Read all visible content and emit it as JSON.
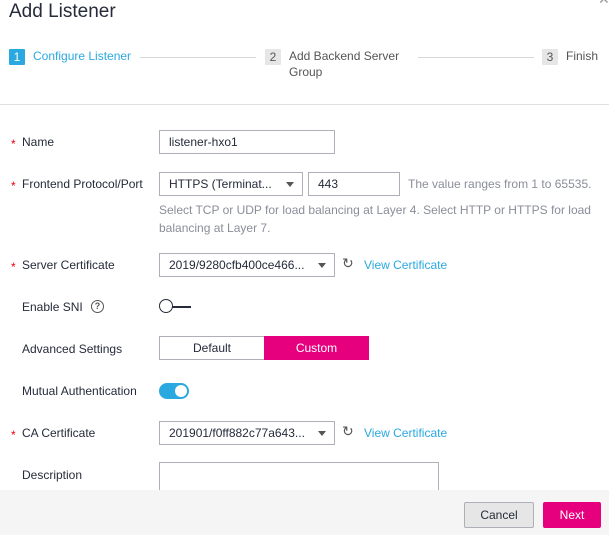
{
  "dialog": {
    "title": "Add Listener"
  },
  "stepper": [
    {
      "num": "1",
      "label": "Configure Listener",
      "state": "active"
    },
    {
      "num": "2",
      "label_line1": "Add Backend Server",
      "label_line2": "Group",
      "state": "inactive"
    },
    {
      "num": "3",
      "label": "Finish",
      "state": "inactive"
    }
  ],
  "form": {
    "name": {
      "label": "Name",
      "value": "listener-hxo1"
    },
    "frontend": {
      "label": "Frontend Protocol/Port",
      "protocol": "HTTPS (Terminat...",
      "port": "443",
      "port_hint": "The value ranges from 1 to 65535.",
      "help_line1": "Select TCP or UDP for load balancing at Layer 4. Select HTTP or HTTPS for load",
      "help_line2": "balancing at Layer 7."
    },
    "server_cert": {
      "label": "Server Certificate",
      "value": "2019/9280cfb400ce466...",
      "link": "View Certificate"
    },
    "sni": {
      "label": "Enable SNI",
      "enabled": false
    },
    "advanced": {
      "label": "Advanced Settings",
      "options": [
        "Default",
        "Custom"
      ],
      "selected": "Custom"
    },
    "mutual_auth": {
      "label": "Mutual Authentication",
      "enabled": true
    },
    "ca_cert": {
      "label": "CA Certificate",
      "value": "201901/f0ff882c77a643...",
      "link": "View Certificate"
    },
    "description": {
      "label": "Description",
      "value": ""
    }
  },
  "footer": {
    "cancel": "Cancel",
    "next": "Next"
  },
  "colors": {
    "accent": "#2aa9e0",
    "primary": "#e6007e",
    "required": "#e60012"
  }
}
